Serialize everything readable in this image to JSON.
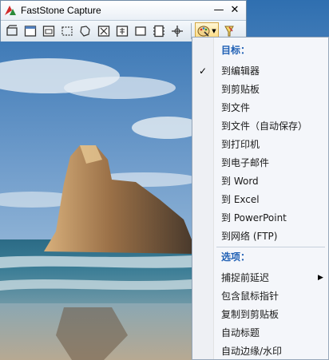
{
  "window": {
    "title": "FastStone Capture",
    "minimize_label": "—",
    "close_label": "✕"
  },
  "toolbar": {
    "tools": [
      {
        "icon": "capture-active-window-icon"
      },
      {
        "icon": "capture-window-object-icon"
      },
      {
        "icon": "capture-rectangle-icon"
      },
      {
        "icon": "capture-freehand-icon"
      },
      {
        "icon": "capture-full-screen-icon"
      },
      {
        "icon": "capture-scrolling-window-icon"
      },
      {
        "icon": "capture-fixed-region-icon"
      },
      {
        "icon": "video-recorder-icon"
      },
      {
        "icon": "crosshair-icon"
      },
      {
        "icon": "output-destination-icon"
      },
      {
        "icon": "settings-icon"
      }
    ]
  },
  "menu": {
    "sections": [
      {
        "header": "目标：",
        "items": [
          {
            "label": "到编辑器",
            "checked": true
          },
          {
            "label": "到剪贴板"
          },
          {
            "label": "到文件"
          },
          {
            "label": "到文件（自动保存）"
          },
          {
            "label": "到打印机"
          },
          {
            "label": "到电子邮件"
          },
          {
            "label": "到 Word"
          },
          {
            "label": "到 Excel"
          },
          {
            "label": "到 PowerPoint"
          },
          {
            "label": "到网络 (FTP)"
          }
        ]
      },
      {
        "header": "选项：",
        "items": [
          {
            "label": "捕捉前延迟",
            "submenu": true
          },
          {
            "label": "包含鼠标指针"
          },
          {
            "label": "复制到剪贴板"
          },
          {
            "label": "自动标题"
          },
          {
            "label": "自动边缘/水印"
          }
        ]
      }
    ],
    "check_glyph": "✓",
    "submenu_glyph": "▶"
  },
  "colors": {
    "menu_header": "#1e5fb4",
    "selected_tool_bg": "#ffd979"
  }
}
